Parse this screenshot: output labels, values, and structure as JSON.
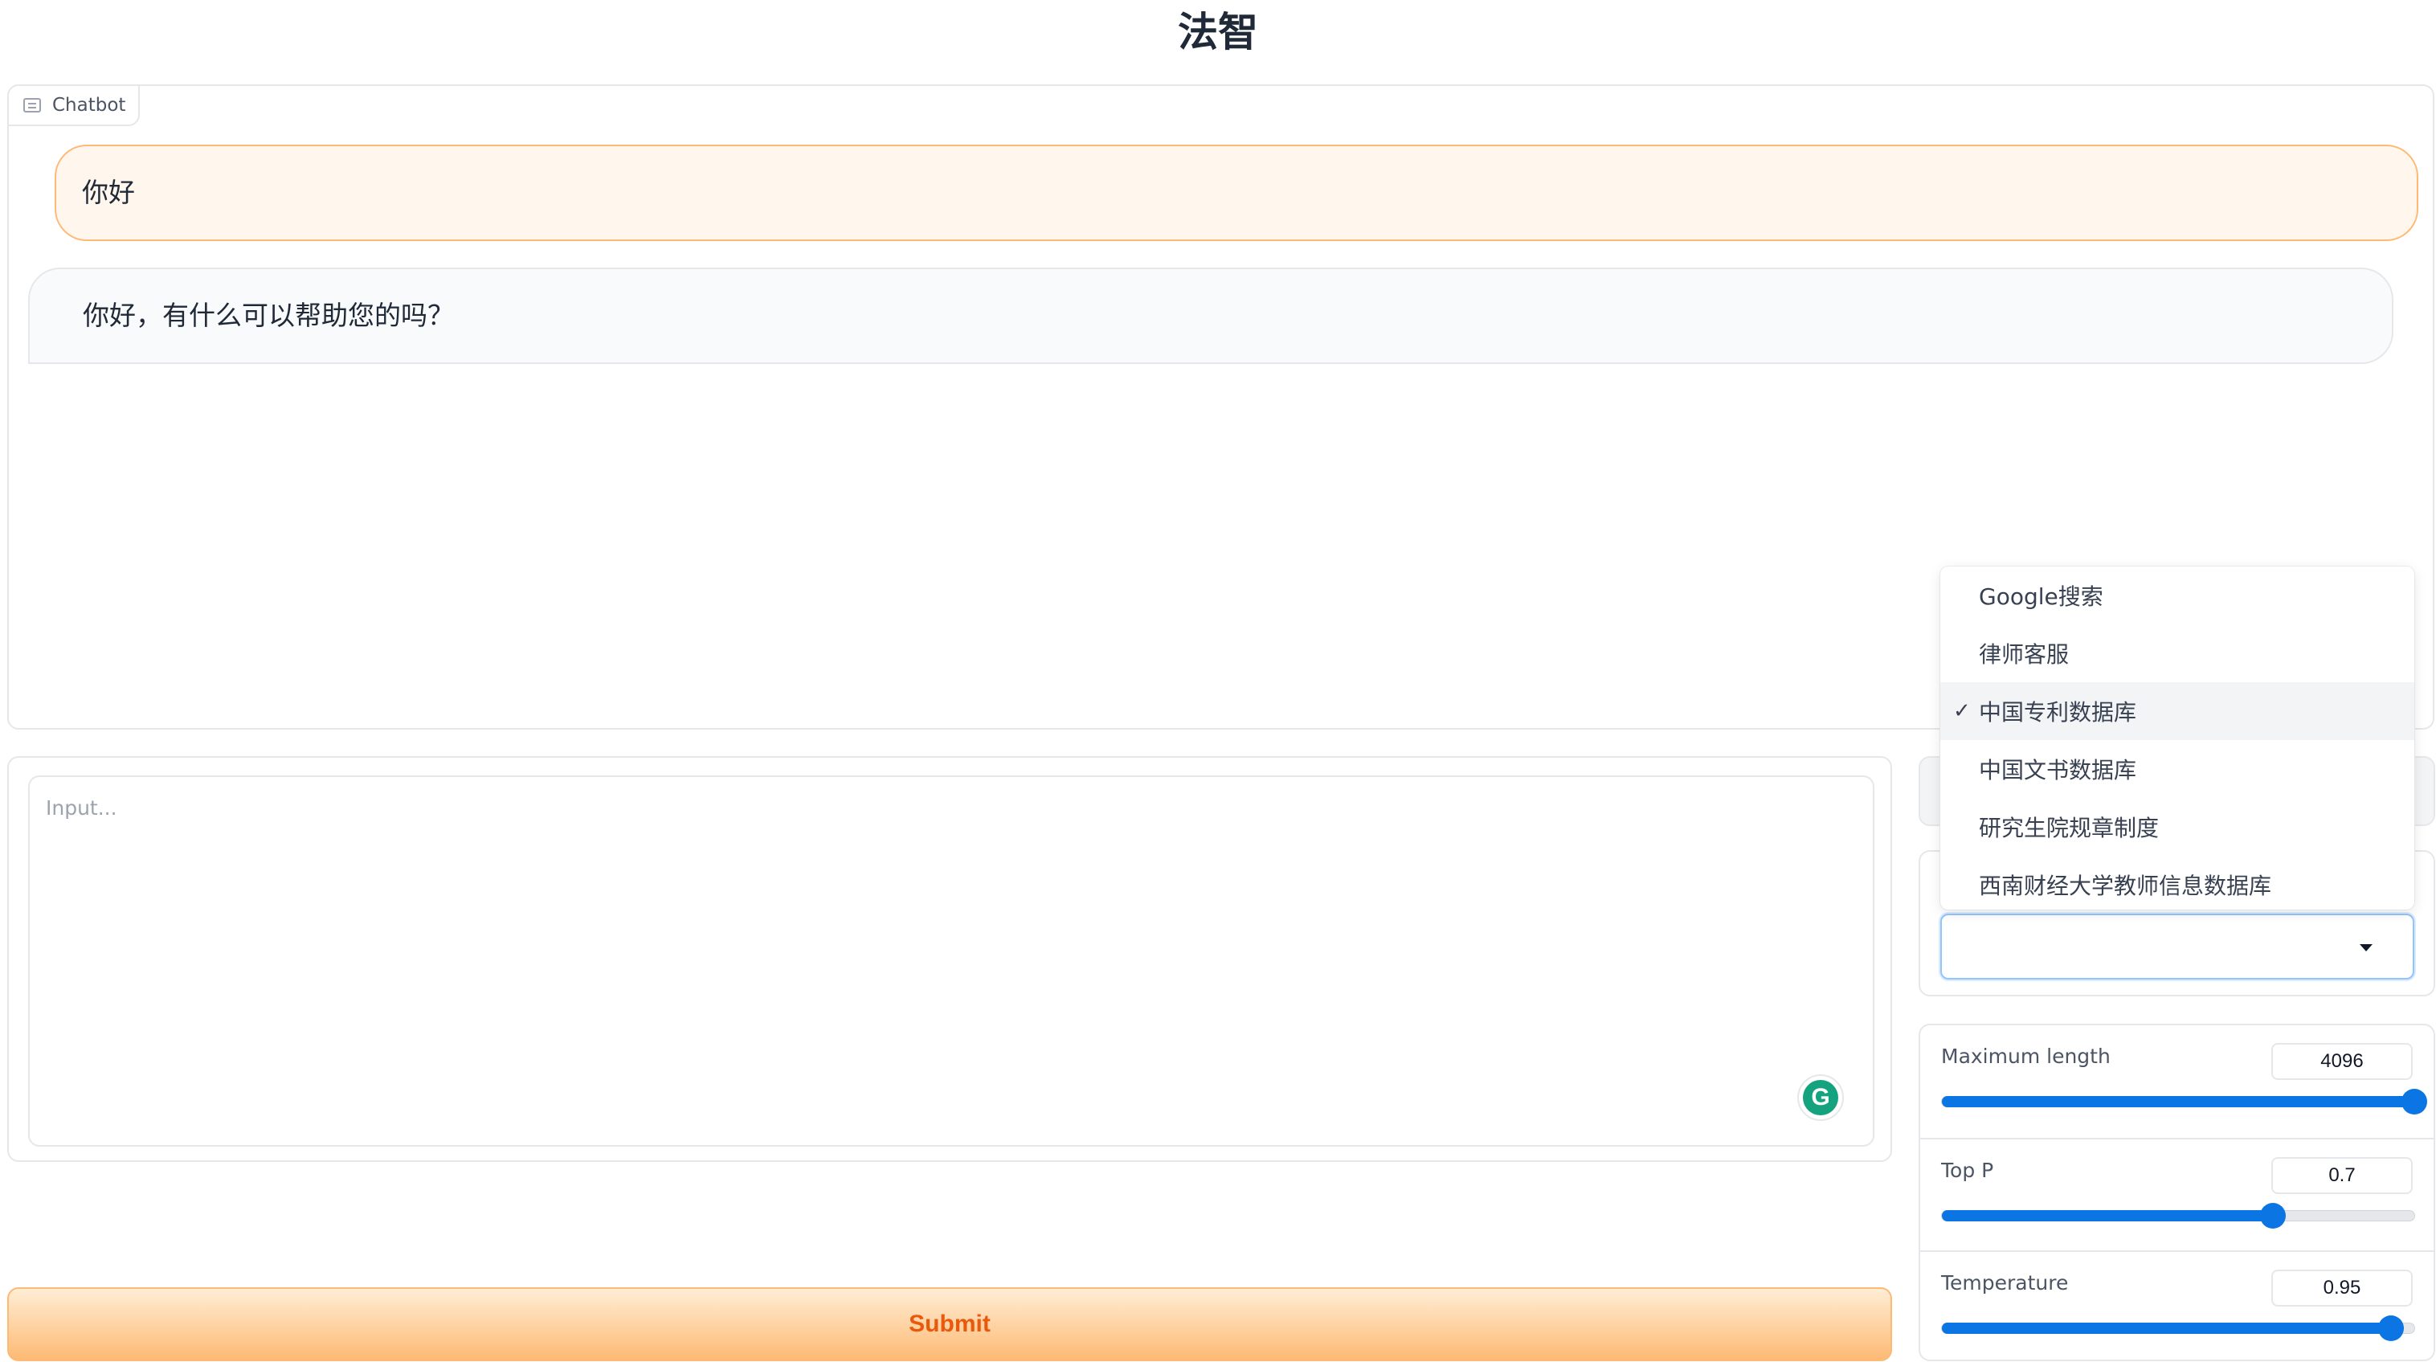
{
  "app": {
    "title": "法智"
  },
  "chatbot": {
    "label": "Chatbot",
    "messages": [
      {
        "role": "user",
        "text": "你好"
      },
      {
        "role": "assistant",
        "text": "你好，有什么可以帮助您的吗？"
      }
    ]
  },
  "input": {
    "placeholder": "Input..."
  },
  "submit": {
    "label": "Submit"
  },
  "knowledge_select": {
    "selected": "中国专利数据库",
    "options": [
      "Google搜索",
      "律师客服",
      "中国专利数据库",
      "中国文书数据库",
      "研究生院规章制度",
      "西南财经大学教师信息数据库"
    ],
    "check_mark": "✓"
  },
  "params": {
    "max_length": {
      "label": "Maximum length",
      "value": "4096",
      "fraction": 1.0
    },
    "top_p": {
      "label": "Top P",
      "value": "0.7",
      "fraction": 0.7
    },
    "temperature": {
      "label": "Temperature",
      "value": "0.95",
      "fraction": 0.95
    }
  },
  "colors": {
    "accent_blue": "#0b76e3",
    "submit_text": "#ea580c",
    "user_bubble_bg": "#fff7ed",
    "user_bubble_border": "#fdba74"
  }
}
